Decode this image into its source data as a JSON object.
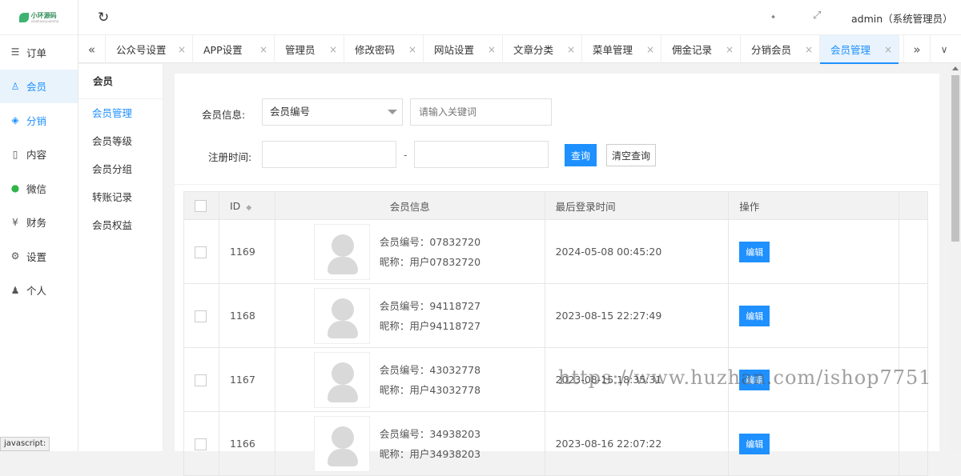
{
  "logo": {
    "text": "小环源码",
    "sub": "xiaohuanyuanma"
  },
  "sidebar": {
    "items": [
      {
        "label": "订单",
        "icon": "list-icon"
      },
      {
        "label": "会员",
        "icon": "user-icon"
      },
      {
        "label": "分销",
        "icon": "layers-icon"
      },
      {
        "label": "内容",
        "icon": "book-icon"
      },
      {
        "label": "微信",
        "icon": "wechat-icon"
      },
      {
        "label": "财务",
        "icon": "yen-icon"
      },
      {
        "label": "设置",
        "icon": "gear-icon"
      },
      {
        "label": "个人",
        "icon": "person-icon"
      }
    ],
    "active_index": 1
  },
  "header": {
    "user": "admin（系统管理员）"
  },
  "tabs": [
    {
      "label": "公众号设置"
    },
    {
      "label": "APP设置"
    },
    {
      "label": "管理员"
    },
    {
      "label": "修改密码"
    },
    {
      "label": "网站设置"
    },
    {
      "label": "文章分类"
    },
    {
      "label": "菜单管理"
    },
    {
      "label": "佣金记录"
    },
    {
      "label": "分销会员"
    },
    {
      "label": "会员管理"
    }
  ],
  "subnav": {
    "title": "会员",
    "items": [
      "会员管理",
      "会员等级",
      "会员分组",
      "转账记录",
      "会员权益"
    ]
  },
  "filter": {
    "member_info_label": "会员信息:",
    "select_value": "会员编号",
    "keyword_placeholder": "请输入关键词",
    "reg_time_label": "注册时间:",
    "range_sep": "-",
    "search_label": "查询",
    "clear_label": "清空查询"
  },
  "table": {
    "headers": {
      "id": "ID",
      "info": "会员信息",
      "last_login": "最后登录时间",
      "action": "操作"
    },
    "rows": [
      {
        "id": "1169",
        "code": "会员编号：07832720",
        "nick": "昵称：用户07832720",
        "last_login": "2024-05-08 00:45:20",
        "action": "编辑"
      },
      {
        "id": "1168",
        "code": "会员编号：94118727",
        "nick": "昵称：用户94118727",
        "last_login": "2023-08-15 22:27:49",
        "action": "编辑"
      },
      {
        "id": "1167",
        "code": "会员编号：43032778",
        "nick": "昵称：用户43032778",
        "last_login": "2023-08-15 18:35:31",
        "action": "编辑"
      },
      {
        "id": "1166",
        "code": "会员编号：34938203",
        "nick": "昵称：用户34938203",
        "last_login": "2023-08-16 22:07:22",
        "action": "编辑"
      }
    ]
  },
  "watermark": "https://www.huzhan.com/ishop7751",
  "statusbar": "javascript:",
  "colors": {
    "accent": "#1e90ff",
    "wechat": "#2fb44a"
  }
}
